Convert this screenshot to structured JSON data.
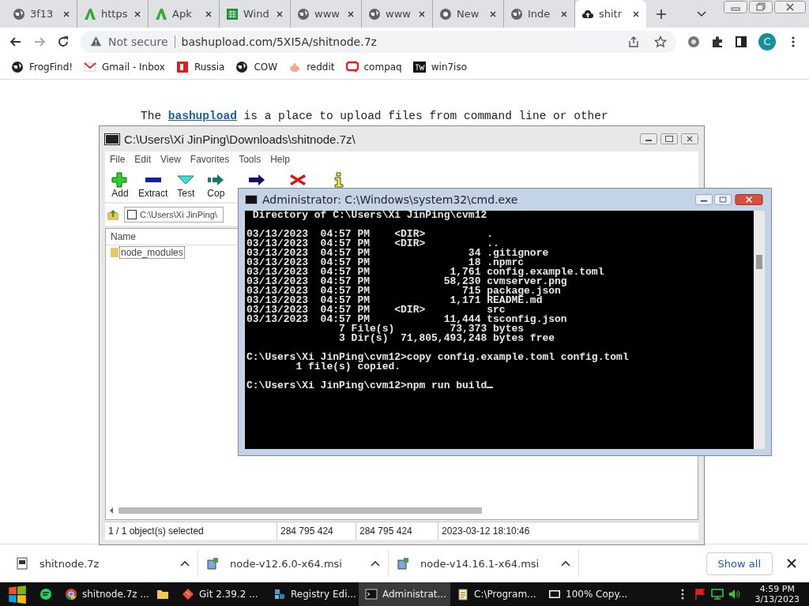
{
  "browser": {
    "tabs": [
      {
        "label": "3f13",
        "kind": "globe",
        "selected": false
      },
      {
        "label": "https",
        "kind": "letter",
        "selected": false
      },
      {
        "label": "Apk",
        "kind": "letter",
        "selected": false
      },
      {
        "label": "Wind",
        "kind": "grid",
        "selected": false
      },
      {
        "label": "www",
        "kind": "globe",
        "selected": false
      },
      {
        "label": "www",
        "kind": "globe",
        "selected": false
      },
      {
        "label": "New",
        "kind": "chrome",
        "selected": false
      },
      {
        "label": "Inde",
        "kind": "globe",
        "selected": false
      },
      {
        "label": "shitr",
        "kind": "cloud",
        "selected": true
      }
    ],
    "security": "Not secure",
    "url": "bashupload.com/5XI5A/shitnode.7z",
    "profile": "C",
    "bookmarks": [
      {
        "label": "FrogFind!",
        "kind": "globe"
      },
      {
        "label": "Gmail - Inbox",
        "kind": "mail"
      },
      {
        "label": "Russia",
        "kind": "flag"
      },
      {
        "label": "COW",
        "kind": "globe"
      },
      {
        "label": "reddit",
        "kind": "reddit"
      },
      {
        "label": "compaq",
        "kind": "compaq"
      },
      {
        "label": "win7iso",
        "kind": "tw"
      }
    ]
  },
  "page": {
    "intro_before": "The",
    "intro_link": "bashupload",
    "intro_after": "is a place to upload files from command line or other"
  },
  "archiver": {
    "title": "C:\\Users\\Xi JinPing\\Downloads\\shitnode.7z\\",
    "menu": [
      "File",
      "Edit",
      "View",
      "Favorites",
      "Tools",
      "Help"
    ],
    "toolbar": [
      {
        "label": "Add",
        "kind": "add"
      },
      {
        "label": "Extract",
        "kind": "extract"
      },
      {
        "label": "Test",
        "kind": "test"
      },
      {
        "label": "Cop",
        "kind": "copy"
      },
      {
        "kind": "move"
      },
      {
        "kind": "delete"
      },
      {
        "kind": "info"
      }
    ],
    "path": "C:\\Users\\Xi JinPing\\",
    "column": "Name",
    "rows": [
      {
        "name": "node_modules",
        "selected": true
      }
    ],
    "status": [
      "1 / 1 object(s) selected",
      "284 795 424",
      "284 795 424",
      "2023-03-12 18:10:46"
    ]
  },
  "console": {
    "title": "Administrator: C:\\Windows\\system32\\cmd.exe",
    "cursor": true,
    "blocks": [
      [
        " Directory of C:\\Users\\Xi JinPing\\cvm12"
      ],
      [
        "03/13/2023  04:57 PM    <DIR>          .",
        "03/13/2023  04:57 PM    <DIR>          ..",
        "03/13/2023  04:57 PM                34 .gitignore",
        "03/13/2023  04:57 PM                18 .npmrc",
        "03/13/2023  04:57 PM             1,761 config.example.toml",
        "03/13/2023  04:57 PM            58,230 cvmserver.png",
        "03/13/2023  04:57 PM               715 package.json",
        "03/13/2023  04:57 PM             1,171 README.md",
        "03/13/2023  04:57 PM    <DIR>          src",
        "03/13/2023  04:57 PM            11,444 tsconfig.json",
        "               7 File(s)         73,373 bytes",
        "               3 Dir(s)  71,805,493,248 bytes free"
      ],
      [
        "C:\\Users\\Xi JinPing\\cvm12>copy config.example.toml config.toml",
        "        1 file(s) copied."
      ],
      [
        "C:\\Users\\Xi JinPing\\cvm12>npm run build"
      ]
    ]
  },
  "downloads": {
    "items": [
      {
        "name": "shitnode.7z",
        "kind": "archive"
      },
      {
        "name": "node-v12.6.0-x64.msi",
        "kind": "installer"
      },
      {
        "name": "node-v14.16.1-x64.msi",
        "kind": "installer"
      }
    ],
    "show_all": "Show all"
  },
  "taskbar": {
    "apps": [
      {
        "kind": "chat",
        "selected": false
      },
      {
        "label": "shitnode.7z ...",
        "kind": "chrome",
        "selected": false
      },
      {
        "kind": "folder",
        "selected": false
      },
      {
        "label": "Git 2.39.2 ...",
        "kind": "git",
        "selected": false
      },
      {
        "label": "Registry Edi...",
        "kind": "registry",
        "selected": false
      },
      {
        "label": "Administrat...",
        "kind": "console",
        "selected": true
      },
      {
        "label": "C:\\Program...",
        "kind": "notepad",
        "selected": false
      },
      {
        "label": "100% Copy...",
        "kind": "sevenzip",
        "selected": false
      }
    ],
    "time": "4:59 PM",
    "date": "3/13/2023"
  }
}
